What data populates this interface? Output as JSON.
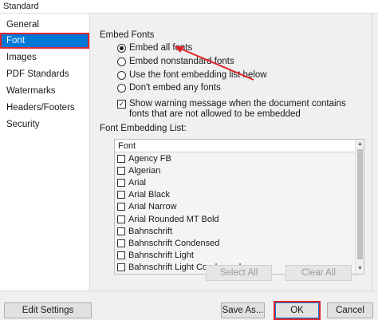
{
  "window": {
    "title": "Standard"
  },
  "sidebar": {
    "items": [
      {
        "label": "General",
        "selected": false
      },
      {
        "label": "Font",
        "selected": true
      },
      {
        "label": "Images",
        "selected": false
      },
      {
        "label": "PDF Standards",
        "selected": false
      },
      {
        "label": "Watermarks",
        "selected": false
      },
      {
        "label": "Headers/Footers",
        "selected": false
      },
      {
        "label": "Security",
        "selected": false
      }
    ]
  },
  "embed_fonts": {
    "title": "Embed Fonts",
    "options": [
      {
        "label": "Embed all fonts",
        "checked": true
      },
      {
        "label": "Embed nonstandard fonts",
        "checked": false
      },
      {
        "label": "Use the font embedding list below",
        "checked": false
      },
      {
        "label": "Don't embed any fonts",
        "checked": false
      }
    ],
    "warning_checkbox": {
      "label": "Show warning message when the document contains fonts that are not allowed to be embedded",
      "checked": true
    }
  },
  "font_list": {
    "title": "Font Embedding List:",
    "column_header": "Font",
    "fonts": [
      "Agency FB",
      "Algerian",
      "Arial",
      "Arial Black",
      "Arial Narrow",
      "Arial Rounded MT Bold",
      "Bahnschrift",
      "Bahnschrift Condensed",
      "Bahnschrift Light",
      "Bahnschrift Light Condensed"
    ],
    "select_all_label": "Select All",
    "clear_all_label": "Clear All"
  },
  "footer": {
    "edit_settings_label": "Edit Settings",
    "save_as_label": "Save As...",
    "ok_label": "OK",
    "cancel_label": "Cancel"
  },
  "colors": {
    "selection": "#0078d7",
    "highlight_border": "#e0262b",
    "annotation_arrow": "#e0262b"
  }
}
